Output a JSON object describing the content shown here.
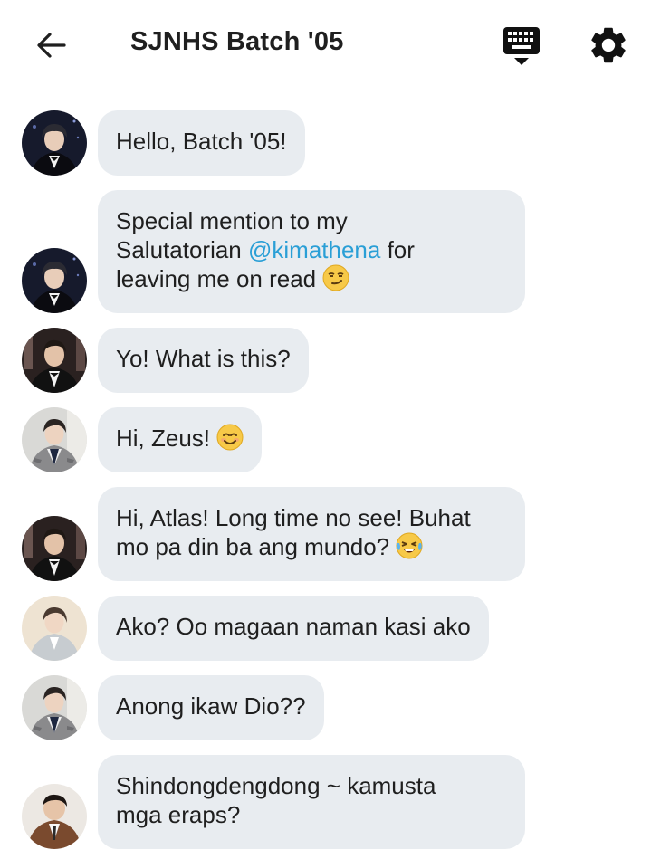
{
  "header": {
    "title": "SJNHS Batch '05",
    "back_icon": "arrow-left-icon",
    "keyboard_icon": "keyboard-icon",
    "settings_icon": "gear-icon"
  },
  "messages": [
    {
      "avatar": "avatar-black-suit",
      "text": "Hello, Batch '05!"
    },
    {
      "avatar": "avatar-black-suit",
      "text_before": "Special mention to my\nSalutatorian ",
      "mention": "@kimathena",
      "text_after": " for\nleaving me on read ",
      "emoji": "smirk-emoji"
    },
    {
      "avatar": "avatar-tuxedo",
      "text": "Yo! What is this?"
    },
    {
      "avatar": "avatar-gray-suit",
      "text": "Hi, Zeus! ",
      "emoji": "smile-emoji"
    },
    {
      "avatar": "avatar-tuxedo",
      "text": "Hi, Atlas! Long time no see! Buhat\nmo pa din ba ang mundo? ",
      "emoji": "laughing-emoji"
    },
    {
      "avatar": "avatar-light-suit",
      "text": "Ako? Oo magaan naman kasi ako"
    },
    {
      "avatar": "avatar-gray-suit",
      "text": "Anong ikaw Dio??"
    },
    {
      "avatar": "avatar-brown-suit",
      "text": "Shindongdengdong ~ kamusta\nmga eraps?"
    }
  ],
  "colors": {
    "bubble": "#e8ecf0",
    "mention": "#2a9fd6"
  }
}
